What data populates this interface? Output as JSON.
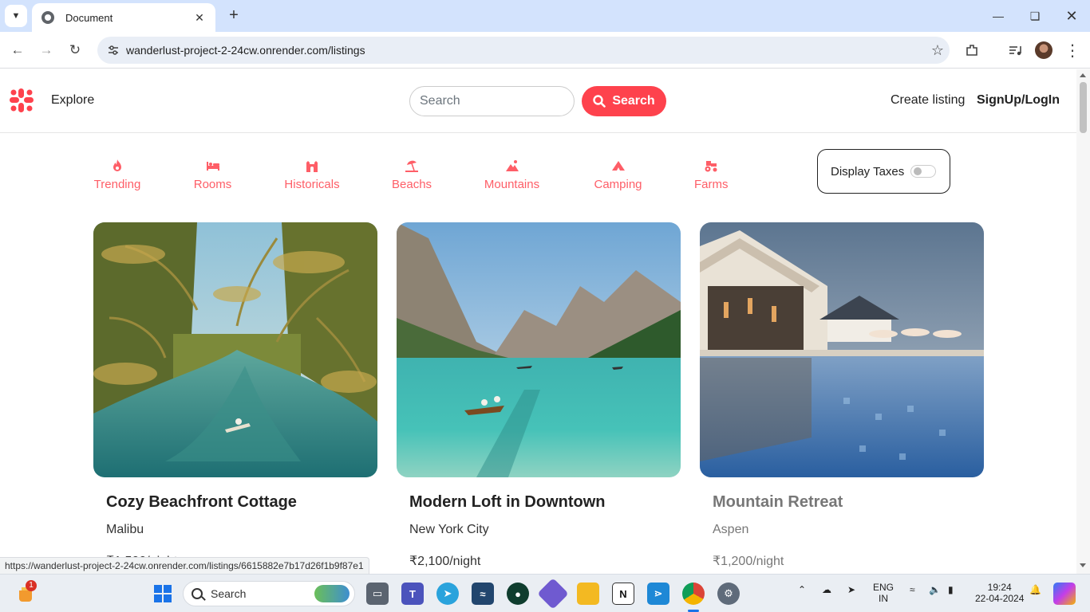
{
  "browser": {
    "tab_title": "Document",
    "url": "wanderlust-project-2-24cw.onrender.com/listings",
    "status_url": "https://wanderlust-project-2-24cw.onrender.com/listings/6615882e7b17d26f1b9f87e1"
  },
  "navbar": {
    "explore_label": "Explore",
    "search_placeholder": "Search",
    "search_button_label": "Search",
    "create_listing_label": "Create listing",
    "signup_login_label": "SignUp/LogIn"
  },
  "filters": [
    {
      "label": "Trending",
      "icon": "fire-icon"
    },
    {
      "label": "Rooms",
      "icon": "bed-icon"
    },
    {
      "label": "Historicals",
      "icon": "castle-icon"
    },
    {
      "label": "Beachs",
      "icon": "umbrella-beach-icon"
    },
    {
      "label": "Mountains",
      "icon": "mountain-icon"
    },
    {
      "label": "Camping",
      "icon": "campground-icon"
    },
    {
      "label": "Farms",
      "icon": "tractor-icon"
    }
  ],
  "tax_toggle": {
    "label": "Display Taxes",
    "checked": false
  },
  "listings": [
    {
      "title": "Cozy Beachfront Cottage",
      "location": "Malibu",
      "price": "₹1,500/night"
    },
    {
      "title": "Modern Loft in Downtown",
      "location": "New York City",
      "price": "₹2,100/night"
    },
    {
      "title": "Mountain Retreat",
      "location": "Aspen",
      "price": "₹1,200/night"
    }
  ],
  "taskbar": {
    "search_label": "Search",
    "notification_count": "1",
    "language_line1": "ENG",
    "language_line2": "IN",
    "time": "19:24",
    "date": "22-04-2024"
  },
  "colors": {
    "accent": "#fe424d"
  }
}
